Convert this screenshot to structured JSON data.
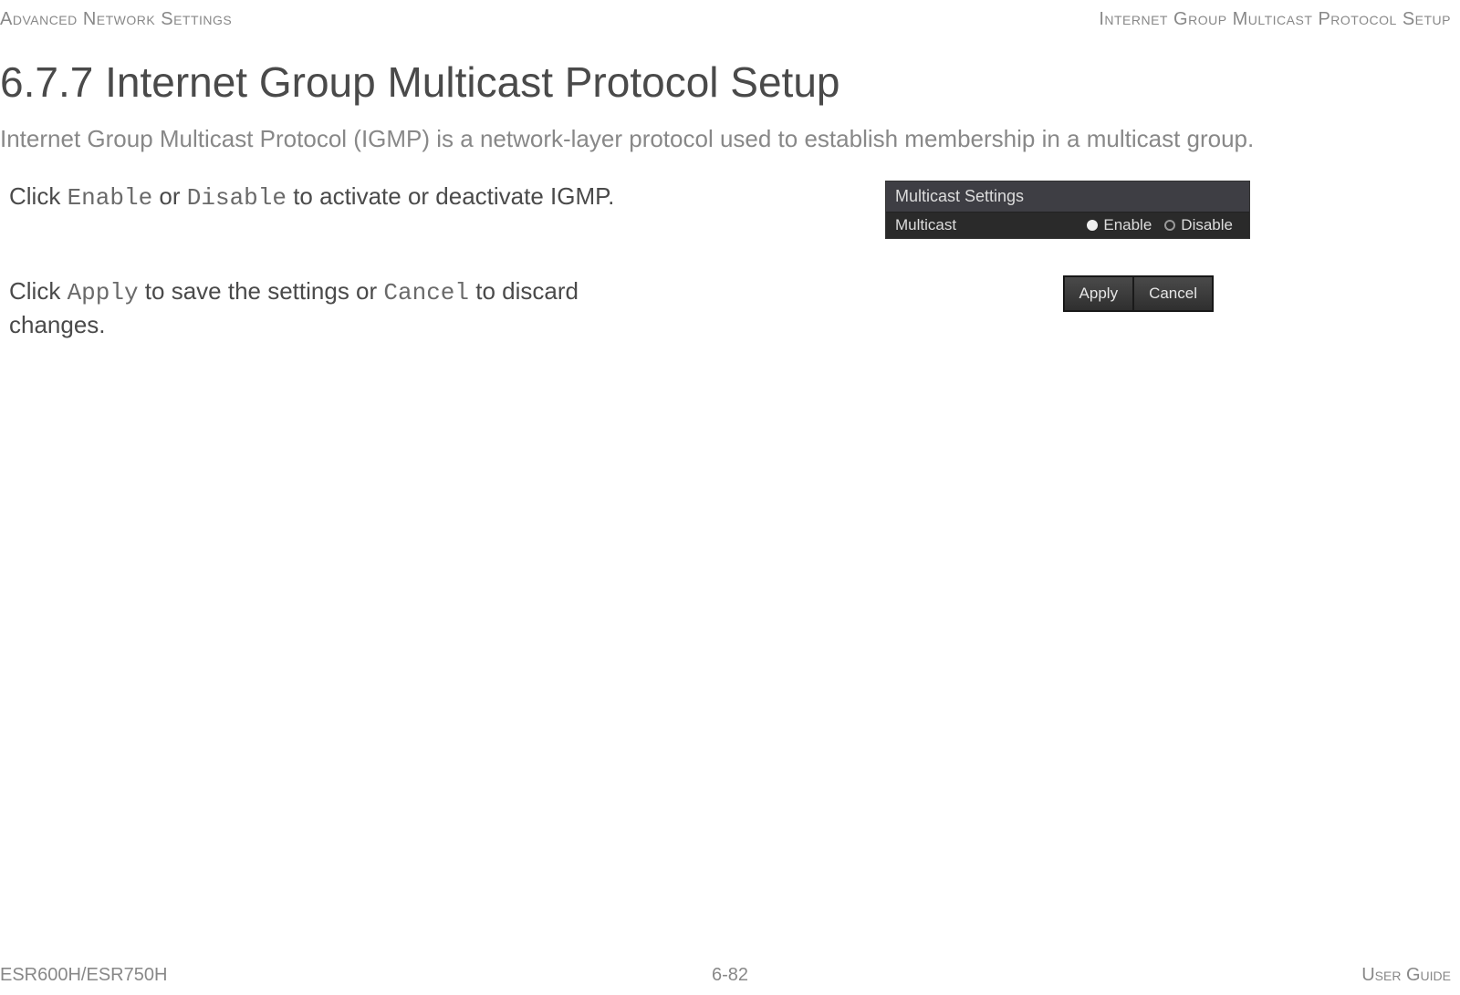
{
  "header": {
    "left": "Advanced Network Settings",
    "right": "Internet Group Multicast Protocol Setup"
  },
  "title": "6.7.7 Internet Group Multicast Protocol Setup",
  "intro": "Internet Group Multicast Protocol (IGMP) is a network-layer protocol used to establish membership in a multicast group.",
  "instruction1": {
    "pre": "Click ",
    "code1": "Enable",
    "mid": " or ",
    "code2": "Disable",
    "post": " to activate or deactivate IGMP."
  },
  "instruction2": {
    "pre": "Click ",
    "code1": "Apply",
    "mid": " to save the settings or ",
    "code2": "Cancel",
    "post": " to discard changes."
  },
  "multicast_widget": {
    "header": "Multicast Settings",
    "label": "Multicast",
    "option_enable": "Enable",
    "option_disable": "Disable",
    "selected": "enable"
  },
  "buttons": {
    "apply": "Apply",
    "cancel": "Cancel"
  },
  "footer": {
    "left": "ESR600H/ESR750H",
    "center": "6-82",
    "right": "User Guide"
  }
}
